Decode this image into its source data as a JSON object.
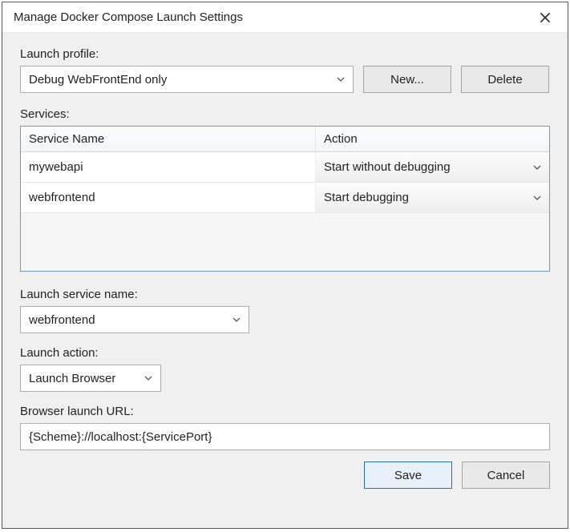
{
  "window": {
    "title": "Manage Docker Compose Launch Settings"
  },
  "labels": {
    "launch_profile": "Launch profile:",
    "services": "Services:",
    "launch_service_name": "Launch service name:",
    "launch_action": "Launch action:",
    "browser_url": "Browser launch URL:"
  },
  "profile": {
    "selected": "Debug WebFrontEnd only",
    "new_btn": "New...",
    "delete_btn": "Delete"
  },
  "services": {
    "headers": {
      "name": "Service Name",
      "action": "Action"
    },
    "rows": [
      {
        "name": "mywebapi",
        "action": "Start without debugging"
      },
      {
        "name": "webfrontend",
        "action": "Start debugging"
      }
    ]
  },
  "launch_service": {
    "selected": "webfrontend"
  },
  "launch_action_combo": {
    "selected": "Launch Browser"
  },
  "browser_url": {
    "value": "{Scheme}://localhost:{ServicePort}"
  },
  "buttons": {
    "save": "Save",
    "cancel": "Cancel"
  }
}
